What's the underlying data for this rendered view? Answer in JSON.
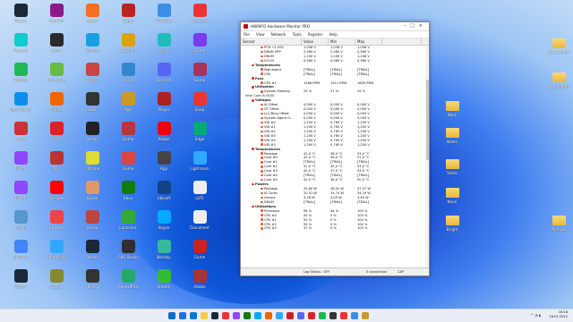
{
  "window": {
    "title": "HWiNFO Hardware Monitor PRO",
    "menu": [
      "File",
      "View",
      "Network",
      "Tools",
      "Register",
      "Help"
    ],
    "columns": [
      "Sensor",
      "Value",
      "Min",
      "Max",
      ""
    ],
    "rows": [
      {
        "k": "item",
        "name": "PCH +1.05V",
        "v": "1,056 V",
        "min": "1,056 V",
        "max": "1,056 V"
      },
      {
        "k": "item",
        "name": "DRAM VPP",
        "v": "2,560 V",
        "min": "2,560 V",
        "max": "2,560 V"
      },
      {
        "k": "item",
        "name": "DRAM",
        "v": "1,200 V",
        "min": "1,200 V",
        "max": "1,208 V"
      },
      {
        "k": "item",
        "name": "VCCIO",
        "v": "0,960 V",
        "min": "0,960 V",
        "max": "0,960 V"
      },
      {
        "k": "grp",
        "name": "Temperatures",
        "v": "",
        "min": "",
        "max": ""
      },
      {
        "k": "item",
        "name": "Mainboard",
        "v": "[TRIAL]",
        "min": "[TRIAL]",
        "max": "[TRIAL]"
      },
      {
        "k": "item",
        "name": "CPU",
        "v": "[TRIAL]",
        "min": "[TRIAL]",
        "max": "[TRIAL]"
      },
      {
        "k": "grp",
        "name": "Fans",
        "v": "",
        "min": "",
        "max": ""
      },
      {
        "k": "item",
        "name": "CPU #1",
        "v": "1566 RPM",
        "min": "1511 RPM",
        "max": "1600 RPM"
      },
      {
        "k": "grp",
        "name": "Utilization",
        "v": "",
        "min": "",
        "max": ""
      },
      {
        "k": "item",
        "name": "System Memory",
        "v": "29 %",
        "min": "27 %",
        "max": "29 %"
      },
      {
        "k": "grp2",
        "name": "Intel Core i5-9400",
        "v": "",
        "min": "",
        "max": ""
      },
      {
        "k": "grp",
        "name": "Voltages",
        "v": "",
        "min": "",
        "max": ""
      },
      {
        "k": "item",
        "name": "IA Offset",
        "v": "0,000 V",
        "min": "0,000 V",
        "max": "0,000 V"
      },
      {
        "k": "item",
        "name": "GT Offset",
        "v": "0,000 V",
        "min": "0,000 V",
        "max": "0,000 V"
      },
      {
        "k": "item",
        "name": "LLC/Ring Offset",
        "v": "0,000 V",
        "min": "0,000 V",
        "max": "0,000 V"
      },
      {
        "k": "item",
        "name": "System Agent O...",
        "v": "0,000 V",
        "min": "0,000 V",
        "max": "0,000 V"
      },
      {
        "k": "item",
        "name": "VID #0",
        "v": "1,200 V",
        "min": "0,765 V",
        "max": "1,200 V"
      },
      {
        "k": "item",
        "name": "VID #1",
        "v": "1,200 V",
        "min": "0,765 V",
        "max": "1,200 V"
      },
      {
        "k": "item",
        "name": "VID #2",
        "v": "1,200 V",
        "min": "0,765 V",
        "max": "1,200 V"
      },
      {
        "k": "item",
        "name": "VID #3",
        "v": "1,200 V",
        "min": "0,765 V",
        "max": "1,200 V"
      },
      {
        "k": "item",
        "name": "VID #4",
        "v": "1,200 V",
        "min": "0,765 V",
        "max": "1,200 V"
      },
      {
        "k": "item",
        "name": "VID #5",
        "v": "1,200 V",
        "min": "0,765 V",
        "max": "1,200 V"
      },
      {
        "k": "grp",
        "name": "Temperatures",
        "v": "",
        "min": "",
        "max": ""
      },
      {
        "k": "item",
        "name": "Package",
        "v": "42,0 °C",
        "min": "38,0 °C",
        "max": "53,0 °C"
      },
      {
        "k": "item",
        "name": "Core #0",
        "v": "42,0 °C",
        "min": "36,0 °C",
        "max": "51,0 °C"
      },
      {
        "k": "item",
        "name": "Core #1",
        "v": "[TRIAL]",
        "min": "[TRIAL]",
        "max": "[TRIAL]"
      },
      {
        "k": "item",
        "name": "Core #2",
        "v": "41,0 °C",
        "min": "35,0 °C",
        "max": "53,0 °C"
      },
      {
        "k": "item",
        "name": "Core #3",
        "v": "40,0 °C",
        "min": "37,0 °C",
        "max": "53,0 °C"
      },
      {
        "k": "item",
        "name": "Core #4",
        "v": "[TRIAL]",
        "min": "[TRIAL]",
        "max": "[TRIAL]"
      },
      {
        "k": "item",
        "name": "Core #5",
        "v": "42,0 °C",
        "min": "36,0 °C",
        "max": "50,0 °C"
      },
      {
        "k": "grp",
        "name": "Powers",
        "v": "",
        "min": "",
        "max": ""
      },
      {
        "k": "item",
        "name": "Package",
        "v": "20,60 W",
        "min": "18,02 W",
        "max": "37,57 W"
      },
      {
        "k": "item",
        "name": "IA Cores",
        "v": "20,31 W",
        "min": "14,74 W",
        "max": "34,19 W"
      },
      {
        "k": "item",
        "name": "Uncore",
        "v": "3,28 W",
        "min": "3,09 W",
        "max": "3,40 W"
      },
      {
        "k": "item",
        "name": "DRAM",
        "v": "[TRIAL]",
        "min": "[TRIAL]",
        "max": "[TRIAL]"
      },
      {
        "k": "grp",
        "name": "Utilizations",
        "v": "",
        "min": "",
        "max": ""
      },
      {
        "k": "item",
        "name": "Processor",
        "v": "58 %",
        "min": "44 %",
        "max": "100 %"
      },
      {
        "k": "item",
        "name": "CPU #0",
        "v": "55 %",
        "min": "0 %",
        "max": "100 %"
      },
      {
        "k": "item",
        "name": "CPU #1",
        "v": "55 %",
        "min": "0 %",
        "max": "100 %"
      },
      {
        "k": "item",
        "name": "CPU #2",
        "v": "55 %",
        "min": "0 %",
        "max": "100 %"
      },
      {
        "k": "item",
        "name": "CPU #3",
        "v": "47 %",
        "min": "0 %",
        "max": "100 %"
      }
    ],
    "status": {
      "log": "Log Status : OFF",
      "conn": "0 connection",
      "cap": "CAP"
    }
  },
  "desktop": {
    "left_icons": [
      {
        "label": "Steam",
        "color": "#1b2838"
      },
      {
        "label": "WinRAR",
        "color": "#8b1a8b"
      },
      {
        "label": "Avast",
        "color": "#f36f21"
      },
      {
        "label": "Setup",
        "color": "#b22"
      },
      {
        "label": "Windows",
        "color": "#3a8ee6"
      },
      {
        "label": "Valorant",
        "color": "#e33"
      },
      {
        "label": "Recuva",
        "color": "#1cc"
      },
      {
        "label": "Lunar",
        "color": "#2a2a2a"
      },
      {
        "label": "Stream",
        "color": "#1a9fe0"
      },
      {
        "label": "CCleaner",
        "color": "#e0a010"
      },
      {
        "label": "Vysor",
        "color": "#2bb"
      },
      {
        "label": "Game",
        "color": "#7a3cf0"
      },
      {
        "label": "Spotify",
        "color": "#1db954"
      },
      {
        "label": "Minecraft",
        "color": "#6b4"
      },
      {
        "label": "Editor",
        "color": "#c44"
      },
      {
        "label": "Voice",
        "color": "#38c"
      },
      {
        "label": "Discord",
        "color": "#5865f2"
      },
      {
        "label": "Game",
        "color": "#a35"
      },
      {
        "label": "TeamViewer",
        "color": "#0e8ee9"
      },
      {
        "label": "Photo",
        "color": "#e60"
      },
      {
        "label": "OBS",
        "color": "#333"
      },
      {
        "label": "App",
        "color": "#c92"
      },
      {
        "label": "Player",
        "color": "#a22"
      },
      {
        "label": "Snap",
        "color": "#e33"
      },
      {
        "label": "Apps",
        "color": "#c33"
      },
      {
        "label": "WPS",
        "color": "#d22"
      },
      {
        "label": "Corsair",
        "color": "#222"
      },
      {
        "label": "Game",
        "color": "#b33"
      },
      {
        "label": "Adobe",
        "color": "#e01"
      },
      {
        "label": "Edge",
        "color": "#0a7"
      },
      {
        "label": "Twitch",
        "color": "#9146ff"
      },
      {
        "label": "Tool",
        "color": "#b33"
      },
      {
        "label": "Chrome",
        "color": "#dd3"
      },
      {
        "label": "Game",
        "color": "#d44"
      },
      {
        "label": "App",
        "color": "#444"
      },
      {
        "label": "Lightroom",
        "color": "#31a8ff"
      },
      {
        "label": "Twitch",
        "color": "#9146ff"
      },
      {
        "label": "YouTube",
        "color": "#f00"
      },
      {
        "label": "Game",
        "color": "#d96"
      },
      {
        "label": "Xbox",
        "color": "#107c10"
      },
      {
        "label": "Ubisoft",
        "color": "#148"
      },
      {
        "label": "LUTs",
        "color": "#eee"
      },
      {
        "label": "Clash",
        "color": "#59c"
      },
      {
        "label": "Chrome",
        "color": "#e44"
      },
      {
        "label": "Game",
        "color": "#b44"
      },
      {
        "label": "Launcher",
        "color": "#3a3"
      },
      {
        "label": "Skype",
        "color": "#0af"
      },
      {
        "label": "Document",
        "color": "#eee"
      },
      {
        "label": "Chrome",
        "color": "#4285f4"
      },
      {
        "label": "Photoshop",
        "color": "#31a8ff"
      },
      {
        "label": "Steam",
        "color": "#1b2838"
      },
      {
        "label": "OBS Studio",
        "color": "#302e31"
      },
      {
        "label": "Nearby",
        "color": "#3b9"
      },
      {
        "label": "Game",
        "color": "#c22"
      },
      {
        "label": "Steam",
        "color": "#1b2838"
      },
      {
        "label": "Game",
        "color": "#883"
      },
      {
        "label": "Camera",
        "color": "#333"
      },
      {
        "label": "OpenOffice",
        "color": "#2a6"
      },
      {
        "label": "Stream",
        "color": "#3b3"
      },
      {
        "label": "Adobe",
        "color": "#a33"
      }
    ],
    "right_icons": [
      {
        "label": "New Folder",
        "type": "folder"
      },
      {
        "label": "Documents",
        "type": "folder"
      },
      {
        "label": "Work",
        "type": "folder"
      },
      {
        "label": "Notes",
        "type": "folder"
      },
      {
        "label": "Video",
        "type": "folder"
      },
      {
        "label": "Neon",
        "type": "folder"
      },
      {
        "label": "Bright",
        "type": "folder"
      },
      {
        "label": "Archive",
        "type": "folder"
      }
    ]
  },
  "taskbar": {
    "time": "16:18",
    "date": "16.01.2022",
    "apps": [
      "#1a73e8",
      "#0078d4",
      "#f7c948",
      "#1b2838",
      "#e33",
      "#9146ff",
      "#107c10",
      "#0af",
      "#e60",
      "#31a8ff",
      "#c22",
      "#5865f2",
      "#d22",
      "#1db954",
      "#333",
      "#e33",
      "#3a8ee6",
      "#c92"
    ]
  }
}
